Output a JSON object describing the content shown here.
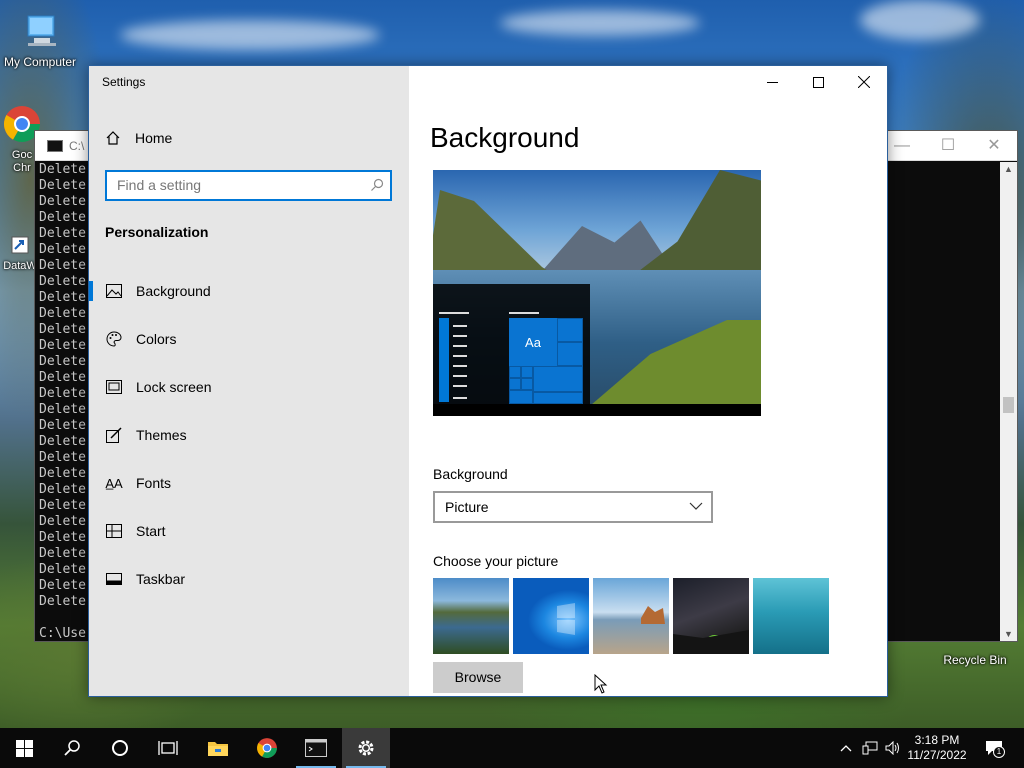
{
  "desktop": {
    "icons": [
      {
        "label": "My Computer"
      },
      {
        "label": "Goc\nChr"
      },
      {
        "label": "DataW"
      },
      {
        "label": "Recycle Bin"
      }
    ]
  },
  "console": {
    "title": "C:\\",
    "lines": "Delete\nDelete\nDelete\nDelete\nDelete\nDelete\nDelete\nDelete\nDelete\nDelete\nDelete\nDelete\nDelete\nDelete\nDelete\nDelete\nDelete\nDelete\nDelete\nDelete\nDelete\nDelete\nDelete\nDelete\nDelete\nDelete\nDelete\nDelete\n\nC:\\Use"
  },
  "settings": {
    "app_title": "Settings",
    "home_label": "Home",
    "search_placeholder": "Find a setting",
    "section_title": "Personalization",
    "nav": [
      {
        "label": "Background",
        "icon": "picture-icon",
        "active": true
      },
      {
        "label": "Colors",
        "icon": "palette-icon"
      },
      {
        "label": "Lock screen",
        "icon": "lock-screen-icon"
      },
      {
        "label": "Themes",
        "icon": "themes-icon"
      },
      {
        "label": "Fonts",
        "icon": "fonts-icon"
      },
      {
        "label": "Start",
        "icon": "start-icon"
      },
      {
        "label": "Taskbar",
        "icon": "taskbar-icon"
      }
    ],
    "page_title": "Background",
    "preview_tile_text": "Aa",
    "background_label": "Background",
    "background_value": "Picture",
    "choose_label": "Choose your picture",
    "browse_label": "Browse",
    "accent_color": "#0078d7"
  },
  "taskbar": {
    "time": "3:18 PM",
    "date": "11/27/2022",
    "notification_count": "1"
  }
}
